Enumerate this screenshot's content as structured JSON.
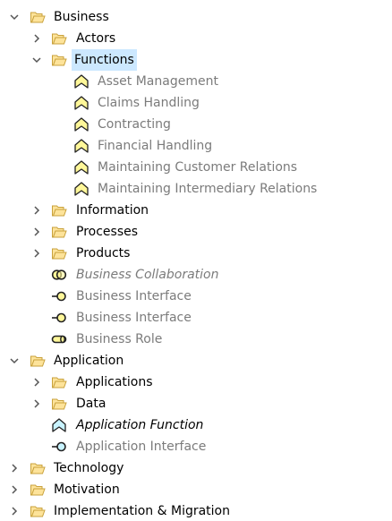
{
  "tree": {
    "business": {
      "label": "Business",
      "actors": "Actors",
      "functions": "Functions",
      "function_items": [
        "Asset Management",
        "Claims Handling",
        "Contracting",
        "Financial Handling",
        "Maintaining Customer Relations",
        "Maintaining Intermediary Relations"
      ],
      "information": "Information",
      "processes": "Processes",
      "products": "Products",
      "collaboration": "Business Collaboration",
      "interface_1": "Business Interface",
      "interface_2": "Business Interface",
      "role": "Business Role"
    },
    "application": {
      "label": "Application",
      "applications": "Applications",
      "data": "Data",
      "function": "Application Function",
      "interface": "Application Interface"
    },
    "technology": "Technology",
    "motivation": "Motivation",
    "implementation": "Implementation & Migration"
  },
  "colors": {
    "folder_fill": "#fde39a",
    "folder_stroke": "#c9a23c",
    "business_fill": "#fff799",
    "application_fill": "#c8f3ff",
    "selection": "#cce8ff"
  }
}
